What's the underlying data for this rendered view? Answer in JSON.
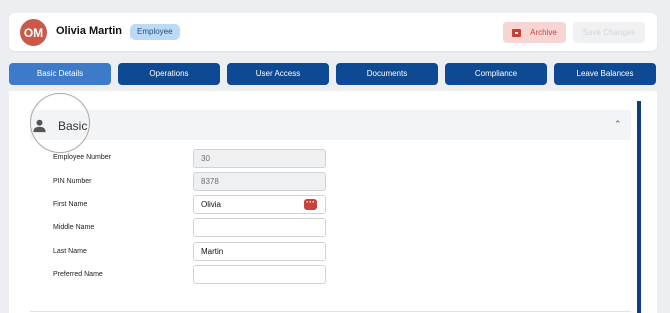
{
  "employee": {
    "initials": "OM",
    "full_name": "Olivia Martin",
    "role_badge": "Employee"
  },
  "actions": {
    "archive_label": "Archive",
    "save_label": "Save Changes"
  },
  "tabs": [
    {
      "label": "Basic Details",
      "active": true
    },
    {
      "label": "Operations",
      "active": false
    },
    {
      "label": "User Access",
      "active": false
    },
    {
      "label": "Documents",
      "active": false
    },
    {
      "label": "Compliance",
      "active": false
    },
    {
      "label": "Leave Balances",
      "active": false
    }
  ],
  "section": {
    "title": "Basic",
    "icon": "person-icon",
    "expanded": true
  },
  "fields": {
    "employee_number": {
      "label": "Employee Number",
      "value": "30",
      "readonly": true
    },
    "pin_number": {
      "label": "PIN Number",
      "value": "8378",
      "readonly": true
    },
    "first_name": {
      "label": "First Name",
      "value": "Olivia"
    },
    "middle_name": {
      "label": "Middle Name",
      "value": ""
    },
    "last_name": {
      "label": "Last Name",
      "value": "Martin"
    },
    "preferred_name": {
      "label": "Preferred Name",
      "value": ""
    }
  },
  "colors": {
    "primary": "#0e4a93",
    "active_tab": "#3d7ac9",
    "danger": "#c9413b",
    "avatar_bg": "#c95a4a"
  }
}
